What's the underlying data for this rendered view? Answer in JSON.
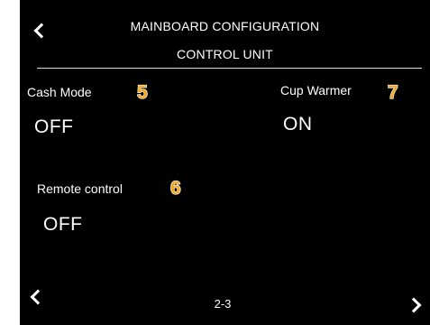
{
  "header": {
    "title": "MAINBOARD CONFIGURATION",
    "subtitle": "CONTROL UNIT"
  },
  "settings": {
    "cash_mode": {
      "label": "Cash Mode",
      "value": "OFF",
      "callout": "5"
    },
    "remote_control": {
      "label": "Remote control",
      "value": "OFF",
      "callout": "6"
    },
    "cup_warmer": {
      "label": "Cup Warmer",
      "value": "ON",
      "callout": "7"
    }
  },
  "footer": {
    "page_indicator": "2-3"
  },
  "icons": {
    "back": "chevron-left-icon",
    "prev": "chevron-left-icon",
    "next": "chevron-right-icon"
  },
  "colors": {
    "background": "#000000",
    "text": "#ffffff",
    "callout": "#f5a623"
  }
}
